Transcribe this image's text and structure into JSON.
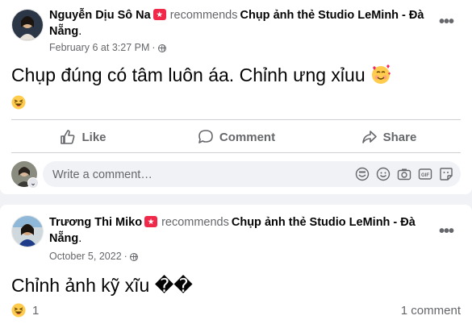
{
  "posts": [
    {
      "author": "Nguyễn Dịu Sô Na",
      "recommends_word": "recommends",
      "page_name": "Chụp ảnh thẻ Studio LeMinh - Đà Nẵng",
      "page_suffix": ".",
      "timestamp": "February 6 at 3:27 PM",
      "separator": "·",
      "content": "Chụp đúng có tâm luôn áa. Chỉnh ưng xỉuu",
      "content_emoji": "smiling-face-with-hearts",
      "reaction": "haha",
      "actions": {
        "like": "Like",
        "comment": "Comment",
        "share": "Share"
      },
      "comment_placeholder": "Write a comment…",
      "comment_tools": [
        "avatar-sticker-icon",
        "emoji-icon",
        "camera-icon",
        "gif-icon",
        "sticker-icon"
      ]
    },
    {
      "author": "Trương Thi Miko",
      "recommends_word": "recommends",
      "page_name": "Chụp ảnh thẻ Studio LeMinh - Đà Nẵng",
      "page_suffix": ".",
      "timestamp": "October 5, 2022",
      "separator": "·",
      "content": "Chỉnh ảnh kỹ xĩu ��",
      "reaction": "haha",
      "reaction_count": "1",
      "comment_count": "1 comment"
    }
  ],
  "more_label": "•••",
  "colors": {
    "secondary_text": "#65676b",
    "badge": "#f02849",
    "divider": "#ced0d4",
    "background": "#f0f2f5"
  }
}
